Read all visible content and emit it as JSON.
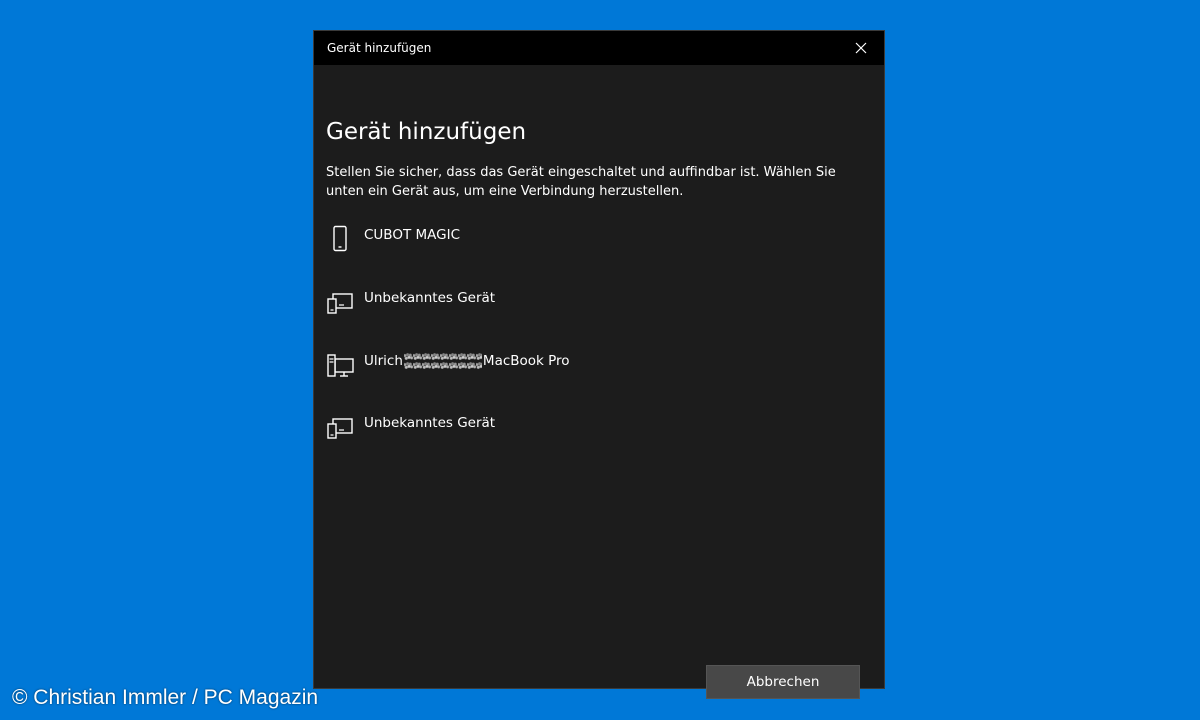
{
  "window": {
    "title": "Gerät hinzufügen",
    "close_icon": "close-icon"
  },
  "dialog": {
    "heading": "Gerät hinzufügen",
    "description": "Stellen Sie sicher, dass das Gerät eingeschaltet und auffindbar ist. Wählen Sie unten ein Gerät aus, um eine Verbindung herzustellen.",
    "devices": [
      {
        "name": "CUBOT MAGIC",
        "icon": "phone-icon"
      },
      {
        "name": "Unbekanntes Gerät",
        "icon": "device-icon"
      },
      {
        "name_prefix": "Ulrich",
        "name_suffix": "MacBook Pro",
        "icon": "computer-icon",
        "redacted": true
      },
      {
        "name": "Unbekanntes Gerät",
        "icon": "device-icon"
      }
    ],
    "cancel_label": "Abbrechen"
  },
  "watermark": "© Christian Immler / PC Magazin",
  "colors": {
    "desktop": "#0078d7",
    "dialog_bg": "#1c1c1c",
    "titlebar_bg": "#000000",
    "button_bg": "#484848"
  }
}
